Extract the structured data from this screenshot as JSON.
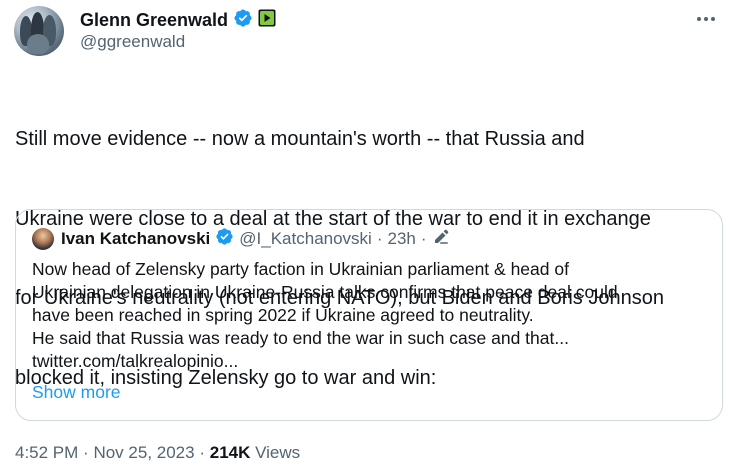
{
  "author": {
    "name": "Glenn Greenwald",
    "handle": "@ggreenwald",
    "verified_icon": "verified-badge-icon",
    "extra_badge_icon": "rumble-play-icon"
  },
  "tweet": {
    "lines": [
      "Still move evidence -- now a mountain's worth -- that Russia and",
      "Ukraine were close to a deal at the start of the war to end it in exchange",
      "for Ukraine's neutrality (not entering NATO), but Biden and Boris Johnson",
      "blocked it, insisting Zelensky go to war and win:"
    ]
  },
  "quote": {
    "name": "Ivan Katchanovski",
    "handle": "@I_Katchanovski",
    "separator": "·",
    "time": "23h",
    "edit_icon": "edit-pencil-icon",
    "lines": [
      "Now head of Zelensky party faction in Ukrainian parliament & head of",
      "Ukrainian delegation in Ukraine-Russia talks confirms that peace deal could",
      "have been reached in spring 2022 if Ukraine agreed to neutrality.",
      "He said that Russia was ready to end the war in such case and that...",
      "twitter.com/talkrealopinio..."
    ],
    "show_more": "Show more"
  },
  "meta": {
    "time": "4:52 PM",
    "separator": "·",
    "date": "Nov 25, 2023",
    "views_count": "214K",
    "views_label": "Views"
  },
  "colors": {
    "accent": "#1d9bf0",
    "verified": "#1d9bf0",
    "rumble": "#85c742",
    "secondary_text": "#536471",
    "border": "#cfd9de"
  }
}
